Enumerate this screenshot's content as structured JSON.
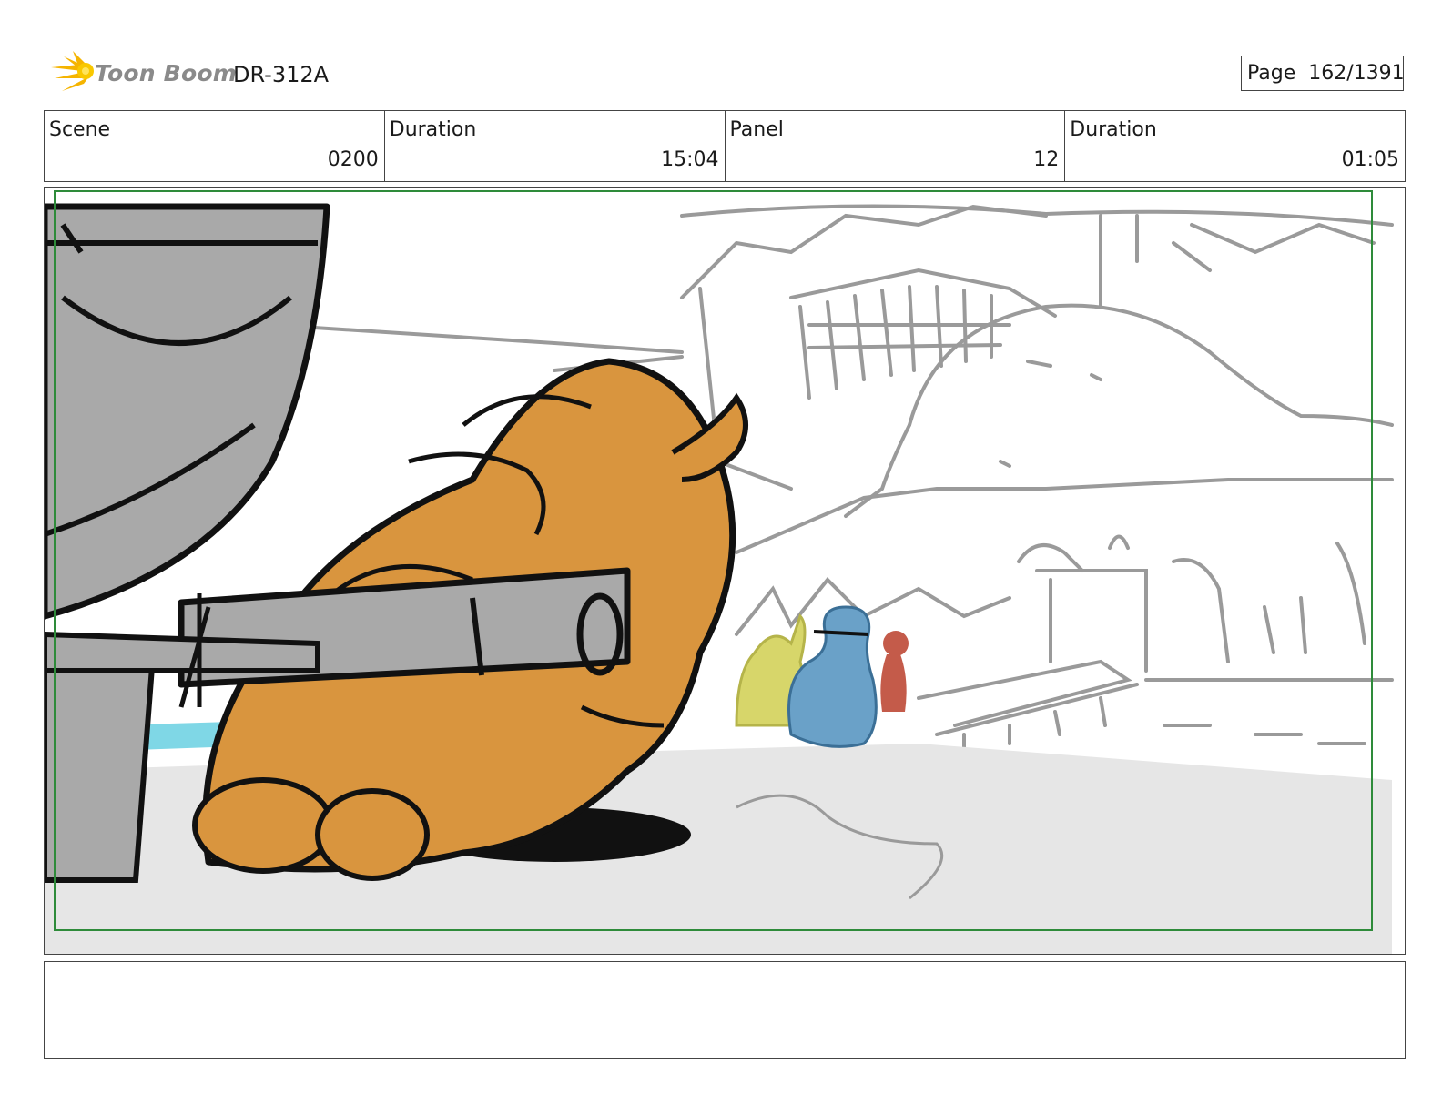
{
  "header": {
    "logo_text": "Toon Boom",
    "doc_id": "DR-312A",
    "page_label": "Page",
    "page_value": "162/1391"
  },
  "info": [
    {
      "label": "Scene",
      "value": "0200"
    },
    {
      "label": "Duration",
      "value": "15:04"
    },
    {
      "label": "Panel",
      "value": "12"
    },
    {
      "label": "Duration",
      "value": "01:05"
    }
  ],
  "colors": {
    "safe_frame": "#2e8b3a",
    "creature": "#d9953e",
    "gray_fill": "#a6a6a6",
    "water": "#7fd7e6",
    "yellow_char": "#d7d66a",
    "blue_char": "#6aa1c8",
    "red_char": "#c45b4a"
  },
  "icons": {
    "logo": "sunburst-logo-icon"
  }
}
